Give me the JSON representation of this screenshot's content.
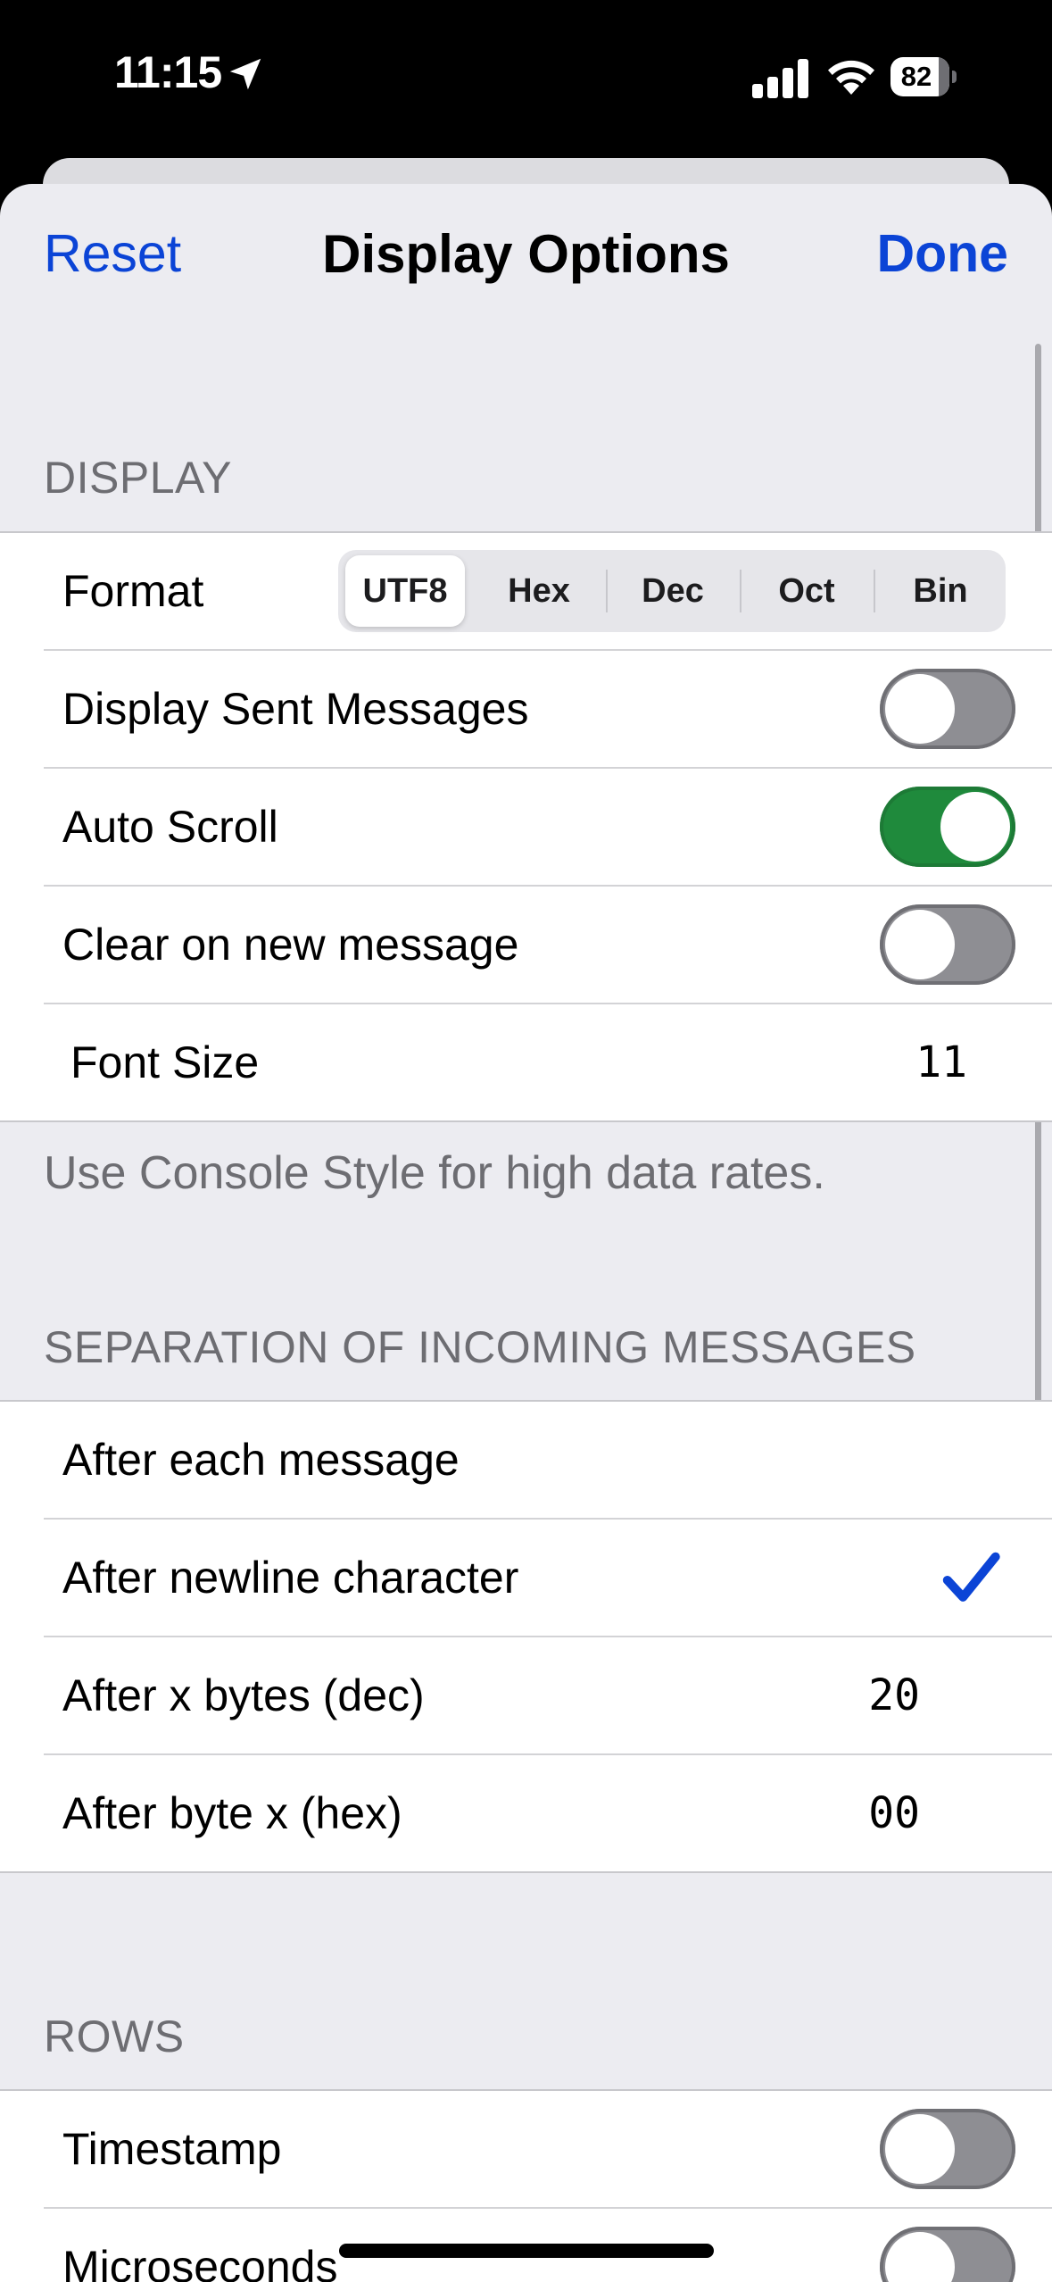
{
  "status_bar": {
    "time": "11:15",
    "battery": "82",
    "location_icon": "location-arrow-icon",
    "signal_icon": "cellular-signal-icon",
    "wifi_icon": "wifi-icon"
  },
  "nav": {
    "reset_label": "Reset",
    "title": "Display Options",
    "done_label": "Done"
  },
  "display": {
    "header": "DISPLAY",
    "format_label": "Format",
    "format_options": [
      "UTF8",
      "Hex",
      "Dec",
      "Oct",
      "Bin"
    ],
    "format_selected": "UTF8",
    "display_sent_label": "Display Sent Messages",
    "display_sent_on": false,
    "auto_scroll_label": "Auto Scroll",
    "auto_scroll_on": true,
    "clear_label": "Clear on new message",
    "clear_on": false,
    "font_size_label": "Font Size",
    "font_size_value": "11",
    "footer": "Use Console Style for high data rates."
  },
  "separation": {
    "header": "SEPARATION OF INCOMING MESSAGES",
    "after_each_label": "After each message",
    "after_newline_label": "After newline character",
    "after_newline_checked": true,
    "after_bytes_label": "After x bytes (dec)",
    "after_bytes_value": "20",
    "after_byte_hex_label": "After byte x (hex)",
    "after_byte_hex_value": "00"
  },
  "rows": {
    "header": "ROWS",
    "timestamp_label": "Timestamp",
    "timestamp_on": false,
    "microseconds_label": "Microseconds",
    "microseconds_on": false
  },
  "colors": {
    "accent": "#0b44d6",
    "toggle_on": "#1f8a3c",
    "toggle_off": "#8e8e93",
    "grouped_background": "#ececf1"
  }
}
